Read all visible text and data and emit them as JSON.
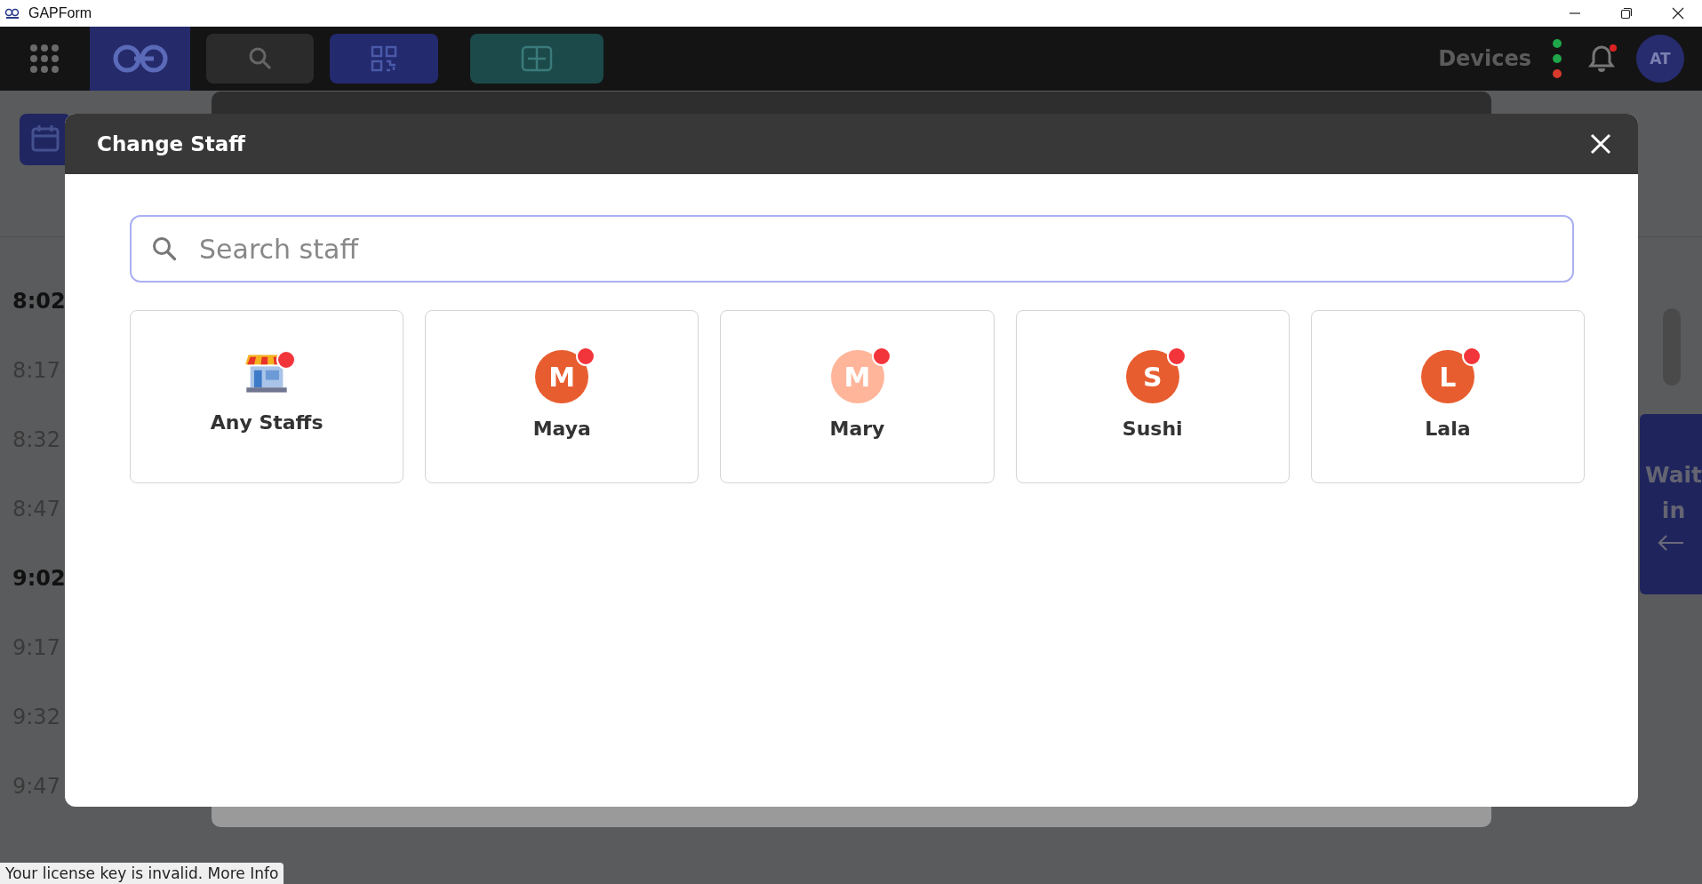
{
  "window": {
    "title": "GAPForm"
  },
  "topbar": {
    "devices_label": "Devices",
    "device_dots": [
      {
        "color": "#1fa64a"
      },
      {
        "color": "#1fa64a"
      },
      {
        "color": "#d83a2e"
      }
    ],
    "notification_unread": true,
    "avatar": "AT"
  },
  "times": [
    {
      "label": "8:02",
      "bold": true
    },
    {
      "label": "8:17",
      "bold": false
    },
    {
      "label": "8:32",
      "bold": false
    },
    {
      "label": "8:47",
      "bold": false
    },
    {
      "label": "9:02",
      "bold": true
    },
    {
      "label": "9:17",
      "bold": false
    },
    {
      "label": "9:32",
      "bold": false
    },
    {
      "label": "9:47",
      "bold": false
    }
  ],
  "side_panel": {
    "label": "Wait in"
  },
  "dialog": {
    "title": "Change Staff",
    "search": {
      "placeholder": "Search staff"
    },
    "staff": [
      {
        "kind": "store",
        "name": "Any Staffs",
        "badge": true
      },
      {
        "kind": "person",
        "name": "Maya",
        "initial": "M",
        "color": "#e85d2f",
        "badge": true
      },
      {
        "kind": "person",
        "name": "Mary",
        "initial": "M",
        "color": "#ffb59a",
        "badge": true
      },
      {
        "kind": "person",
        "name": "Sushi",
        "initial": "S",
        "color": "#e85d2f",
        "badge": true
      },
      {
        "kind": "person",
        "name": "Lala",
        "initial": "L",
        "color": "#e85d2f",
        "badge": true
      }
    ]
  },
  "license_notice": {
    "text": "Your license key is invalid.",
    "link": "More Info"
  }
}
